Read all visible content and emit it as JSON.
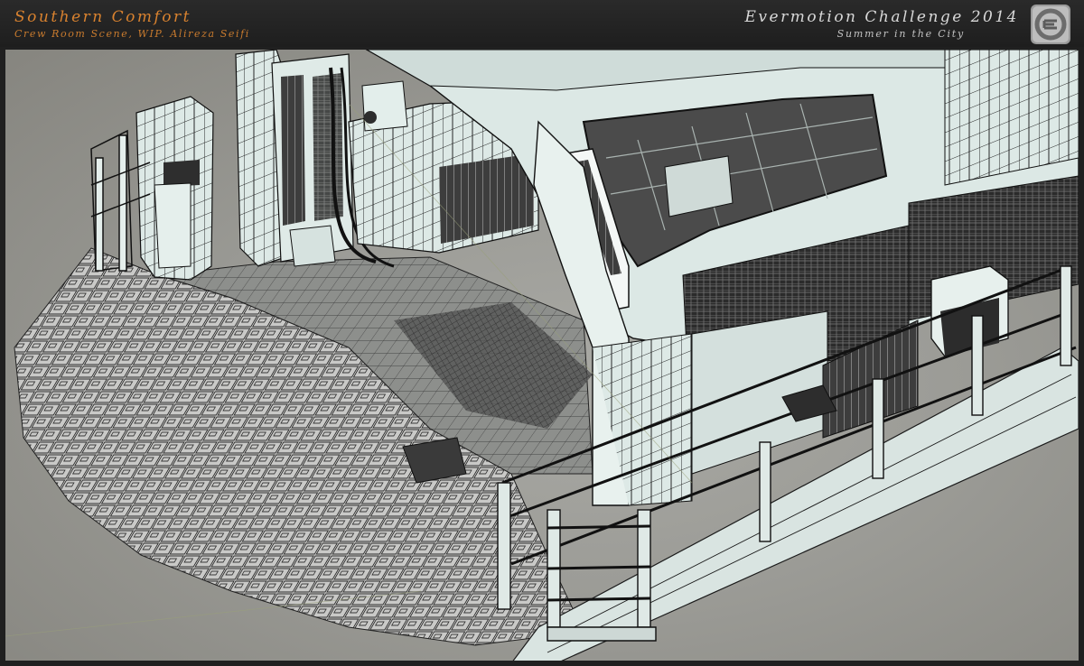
{
  "header": {
    "title_left": "Southern Comfort",
    "subtitle_left": "Crew Room Scene, WIP. Alireza Seifi",
    "title_right": "Evermotion Challenge 2014",
    "subtitle_right": "Summer in the City",
    "logo_icon": "evermotion-e-logo-icon"
  },
  "colors": {
    "title_accent": "#d9822f",
    "title_light": "#d8d8d8",
    "header_bg": "#222222",
    "wire_model": "#e6f2ef",
    "wire_lines": "#101010",
    "viewport_bg": "#9b9b96"
  }
}
